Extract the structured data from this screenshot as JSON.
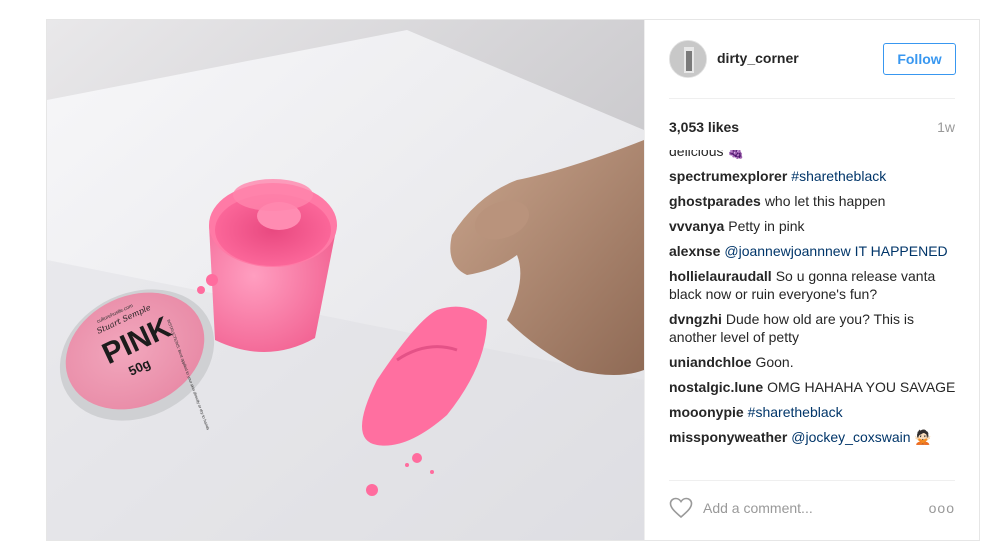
{
  "post": {
    "username": "dirty_corner",
    "follow_label": "Follow",
    "likes": "3,053 likes",
    "time_ago": "1w",
    "comments": [
      {
        "user": "",
        "text": "delicious 🍇"
      },
      {
        "user": "spectrumexplorer",
        "text": "#sharetheblack"
      },
      {
        "user": "ghostparades",
        "text": "who let this happen"
      },
      {
        "user": "vvvanya",
        "text": "Petty in pink"
      },
      {
        "user": "alexnse",
        "text": "@joannewjoannnew IT HAPPENED"
      },
      {
        "user": "hollielauraudall",
        "text": "So u gonna release vanta black now or ruin everyone's fun?"
      },
      {
        "user": "dvngzhi",
        "text": "Dude how old are you? This is another level of petty"
      },
      {
        "user": "uniandchloe",
        "text": "Goon."
      },
      {
        "user": "nostalgic.lune",
        "text": "OMG HAHAHA YOU SAVAGE"
      },
      {
        "user": "mooonypie",
        "text": "#sharetheblack"
      },
      {
        "user": "missponyweather",
        "text": "@jockey_coxswain 🙅🏻"
      }
    ],
    "comment_placeholder": "Add a comment...",
    "more_label": "ooo"
  },
  "photo": {
    "lid_brand": "Stuart Semple",
    "lid_title": "PINK",
    "lid_weight": "50g",
    "lid_site": "culturehustle.com",
    "lid_instructions": "INSTRUCTIONS: Best applied to your skin directly or dry to hands"
  },
  "colors": {
    "accent": "#3897f0",
    "pink": "#f65a8f",
    "mention": "#003569"
  },
  "icons": {
    "heart": "heart-icon",
    "more": "more-options-icon"
  }
}
